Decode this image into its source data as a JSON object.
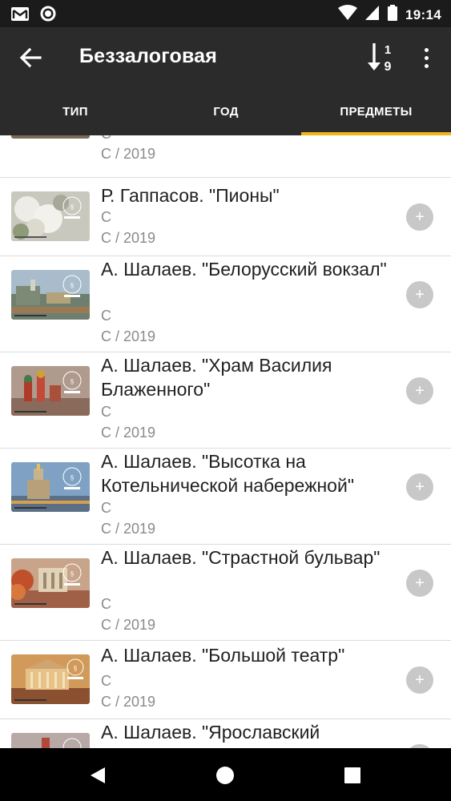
{
  "status_bar": {
    "time": "19:14",
    "icons": [
      "gmail-icon",
      "circle-icon",
      "wifi-icon",
      "signal-icon",
      "battery-icon"
    ]
  },
  "app_bar": {
    "title": "Беззалоговая",
    "sort_icon": "sort-numeric-icon",
    "menu_icon": "more-vert-icon"
  },
  "tabs": [
    {
      "label": "ТИП",
      "active": false
    },
    {
      "label": "ГОД",
      "active": false
    },
    {
      "label": "ПРЕДМЕТЫ",
      "active": true
    }
  ],
  "colors": {
    "app_bar": "#2b2b2b",
    "status_bar": "#1b1b1b",
    "tab_indicator": "#f2b51b",
    "add_button": "#c8c8c8"
  },
  "items": [
    {
      "title": "",
      "type": "С",
      "year": "С / 2019"
    },
    {
      "title": "Р. Гаппасов. \"Пионы\"",
      "type": "С",
      "year": "С / 2019"
    },
    {
      "title": "А. Шалаев. \"Белорусский вокзал\"",
      "type": "С",
      "year": "С / 2019"
    },
    {
      "title": "А. Шалаев. \"Храм Василия Блаженного\"",
      "type": "С",
      "year": "С / 2019"
    },
    {
      "title": "А. Шалаев. \"Высотка на Котельнической набережной\"",
      "type": "С",
      "year": "С / 2019"
    },
    {
      "title": "А. Шалаев. \"Страстной бульвар\"",
      "type": "С",
      "year": "С / 2019"
    },
    {
      "title": "А. Шалаев. \"Большой театр\"",
      "type": "С",
      "year": "С / 2019"
    },
    {
      "title": "А. Шалаев. \"Ярославский",
      "type": "",
      "year": ""
    }
  ],
  "nav_bar": {
    "back_icon": "nav-back-icon",
    "home_icon": "nav-home-icon",
    "recents_icon": "nav-recents-icon"
  }
}
